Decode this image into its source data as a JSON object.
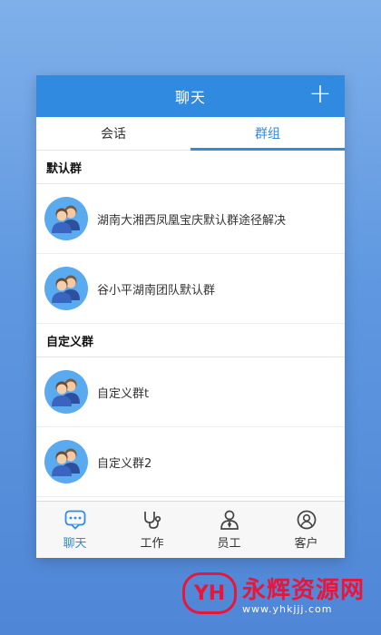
{
  "header": {
    "title": "聊天",
    "add_icon": "plus-icon"
  },
  "tabs": [
    {
      "label": "会话",
      "active": false
    },
    {
      "label": "群组",
      "active": true
    }
  ],
  "sections": [
    {
      "title": "默认群",
      "items": [
        {
          "label": "湖南大湘西凤凰宝庆默认群途径解决"
        },
        {
          "label": "谷小平湖南团队默认群"
        }
      ]
    },
    {
      "title": "自定义群",
      "items": [
        {
          "label": "自定义群t"
        },
        {
          "label": "自定义群2"
        }
      ]
    }
  ],
  "bottom_nav": [
    {
      "label": "聊天",
      "icon": "chat-bubble-icon",
      "active": true
    },
    {
      "label": "工作",
      "icon": "stethoscope-icon",
      "active": false
    },
    {
      "label": "员工",
      "icon": "employee-icon",
      "active": false
    },
    {
      "label": "客户",
      "icon": "customer-icon",
      "active": false
    }
  ],
  "watermark": {
    "title": "永辉资源网",
    "url": "www.yhkjjj.com"
  },
  "colors": {
    "accent": "#2f8ae0",
    "avatar": "#5aaaf0",
    "watermark": "#e8163a"
  }
}
